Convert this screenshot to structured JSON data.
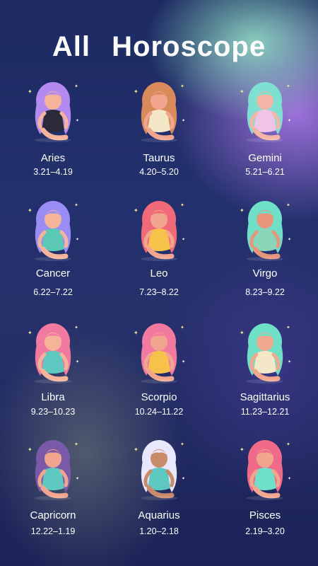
{
  "header": {
    "title": "All   Horoscope"
  },
  "signs": [
    {
      "name": "Aries",
      "dates": "3.21–4.19",
      "hair": "#b58af0",
      "skin": "#f5b49a",
      "accent": "#2a2a3a",
      "icon": "aries-figure-icon"
    },
    {
      "name": "Taurus",
      "dates": "4.20–5.20",
      "hair": "#d98a5a",
      "skin": "#f2a58e",
      "accent": "#f3e7c8",
      "icon": "taurus-figure-icon"
    },
    {
      "name": "Gemini",
      "dates": "5.21–6.21",
      "hair": "#7ee0d0",
      "skin": "#f3b6a6",
      "accent": "#f0c3e8",
      "icon": "gemini-figure-icon"
    },
    {
      "name": "Cancer",
      "dates": "6.22–7.22",
      "hair": "#9a8cf5",
      "skin": "#f5b49a",
      "accent": "#5bc8b5",
      "icon": "cancer-figure-icon"
    },
    {
      "name": "Leo",
      "dates": "7.23–8.22",
      "hair": "#f06a7a",
      "skin": "#f2a58e",
      "accent": "#f6c24a",
      "icon": "leo-figure-icon"
    },
    {
      "name": "Virgo",
      "dates": "8.23–9.22",
      "hair": "#6fe0c8",
      "skin": "#e8957c",
      "accent": "#8ad6b8",
      "icon": "virgo-figure-icon"
    },
    {
      "name": "Libra",
      "dates": "9.23–10.23",
      "hair": "#f27aa0",
      "skin": "#f5b49a",
      "accent": "#5ec9c0",
      "icon": "libra-figure-icon"
    },
    {
      "name": "Scorpio",
      "dates": "10.24–11.22",
      "hair": "#f27aa0",
      "skin": "#f2a58e",
      "accent": "#f6c24a",
      "icon": "scorpio-figure-icon"
    },
    {
      "name": "Sagittarius",
      "dates": "11.23–12.21",
      "hair": "#6fe0c8",
      "skin": "#f0a88e",
      "accent": "#f3e7c8",
      "icon": "sagittarius-figure-icon"
    },
    {
      "name": "Capricorn",
      "dates": "12.22–1.19",
      "hair": "#7a5aa8",
      "skin": "#f2a58e",
      "accent": "#5ec9c0",
      "icon": "capricorn-figure-icon"
    },
    {
      "name": "Aquarius",
      "dates": "1.20–2.18",
      "hair": "#e9e6ff",
      "skin": "#c98a6a",
      "accent": "#5ec9c0",
      "icon": "aquarius-figure-icon"
    },
    {
      "name": "Pisces",
      "dates": "2.19–3.20",
      "hair": "#f06a8a",
      "skin": "#f2a58e",
      "accent": "#6fe0c8",
      "icon": "pisces-figure-icon"
    }
  ]
}
